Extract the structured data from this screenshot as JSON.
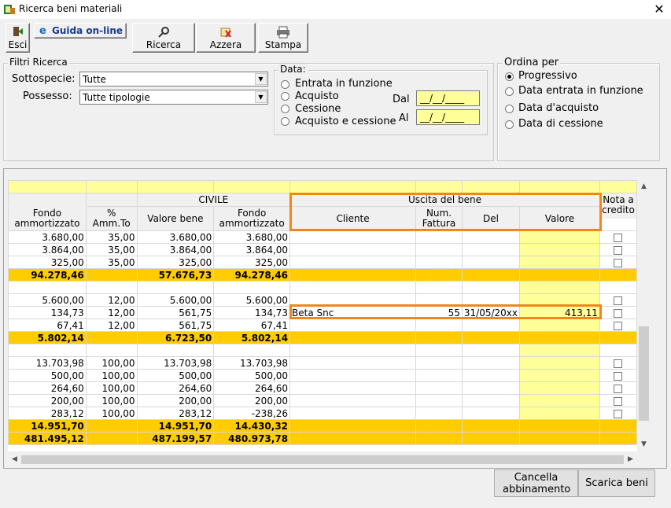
{
  "window": {
    "title": "Ricerca beni materiali",
    "close_glyph": "✕"
  },
  "toolbar": {
    "esci": "Esci",
    "guida": "Guida on-line",
    "ricerca": "Ricerca",
    "azzera": "Azzera",
    "stampa": "Stampa"
  },
  "filters": {
    "legend": "Filtri Ricerca",
    "sottospecie_label": "Sottospecie:",
    "sottospecie_value": "Tutte",
    "possesso_label": "Possesso:",
    "possesso_value": "Tutte tipologie"
  },
  "data_group": {
    "legend": "Data:",
    "options": [
      "Entrata in funzione",
      "Acquisto",
      "Cessione",
      "Acquisto e cessione"
    ],
    "dal_label": "Dal",
    "al_label": "Al",
    "dal_value": "__/__/____",
    "al_value": "__/__/____"
  },
  "ordina": {
    "legend": "Ordina per",
    "options": [
      "Progressivo",
      "Data entrata in funzione",
      "Data d'acquisto",
      "Data di cessione"
    ],
    "selected": "Progressivo"
  },
  "grid": {
    "group_civile": "CIVILE",
    "group_uscita": "Uscita del bene",
    "headers": [
      "Fondo ammortizzato",
      "% Amm.To",
      "Valore bene",
      "Fondo ammortizzato",
      "Cliente",
      "Num. Fattura",
      "Del",
      "Valore",
      "Nota a credito"
    ],
    "rows": [
      {
        "type": "data",
        "cells": [
          "3.680,00",
          "35,00",
          "3.680,00",
          "3.680,00",
          "",
          "",
          "",
          ""
        ],
        "check": true
      },
      {
        "type": "data",
        "cells": [
          "3.864,00",
          "35,00",
          "3.864,00",
          "3.864,00",
          "",
          "",
          "",
          ""
        ],
        "check": true
      },
      {
        "type": "data",
        "cells": [
          "325,00",
          "35,00",
          "325,00",
          "325,00",
          "",
          "",
          "",
          ""
        ],
        "check": true
      },
      {
        "type": "total",
        "cells": [
          "94.278,46",
          "",
          "57.676,73",
          "94.278,46",
          "",
          "",
          "",
          ""
        ],
        "check": false
      },
      {
        "type": "blank",
        "cells": [
          "",
          "",
          "",
          "",
          "",
          "",
          "",
          ""
        ],
        "check": false
      },
      {
        "type": "data",
        "cells": [
          "5.600,00",
          "12,00",
          "5.600,00",
          "5.600,00",
          "",
          "",
          "",
          ""
        ],
        "check": true
      },
      {
        "type": "data",
        "cells": [
          "134,73",
          "12,00",
          "561,75",
          "134,73",
          "Beta Snc",
          "55",
          "31/05/20xx",
          "413,11"
        ],
        "check": true
      },
      {
        "type": "data",
        "cells": [
          "67,41",
          "12,00",
          "561,75",
          "67,41",
          "",
          "",
          "",
          ""
        ],
        "check": true
      },
      {
        "type": "total",
        "cells": [
          "5.802,14",
          "",
          "6.723,50",
          "5.802,14",
          "",
          "",
          "",
          ""
        ],
        "check": false
      },
      {
        "type": "blank",
        "cells": [
          "",
          "",
          "",
          "",
          "",
          "",
          "",
          ""
        ],
        "check": false
      },
      {
        "type": "data",
        "cells": [
          "13.703,98",
          "100,00",
          "13.703,98",
          "13.703,98",
          "",
          "",
          "",
          ""
        ],
        "check": true
      },
      {
        "type": "data",
        "cells": [
          "500,00",
          "100,00",
          "500,00",
          "500,00",
          "",
          "",
          "",
          ""
        ],
        "check": true
      },
      {
        "type": "data",
        "cells": [
          "264,60",
          "100,00",
          "264,60",
          "264,60",
          "",
          "",
          "",
          ""
        ],
        "check": true
      },
      {
        "type": "data",
        "cells": [
          "200,00",
          "100,00",
          "200,00",
          "200,00",
          "",
          "",
          "",
          ""
        ],
        "check": true
      },
      {
        "type": "data",
        "cells": [
          "283,12",
          "100,00",
          "283,12",
          "-238,26",
          "",
          "",
          "",
          ""
        ],
        "check": true
      },
      {
        "type": "total",
        "cells": [
          "14.951,70",
          "",
          "14.951,70",
          "14.430,32",
          "",
          "",
          "",
          ""
        ],
        "check": false
      },
      {
        "type": "total",
        "cells": [
          "481.495,12",
          "",
          "487.199,57",
          "480.973,78",
          "",
          "",
          "",
          ""
        ],
        "check": false
      }
    ]
  },
  "buttons": {
    "cancella": "Cancella abbinamento",
    "scarica": "Scarica beni"
  },
  "colors": {
    "total_row": "#ffcc00",
    "yellow_cell": "#ffff99",
    "highlight": "#f0861e"
  }
}
